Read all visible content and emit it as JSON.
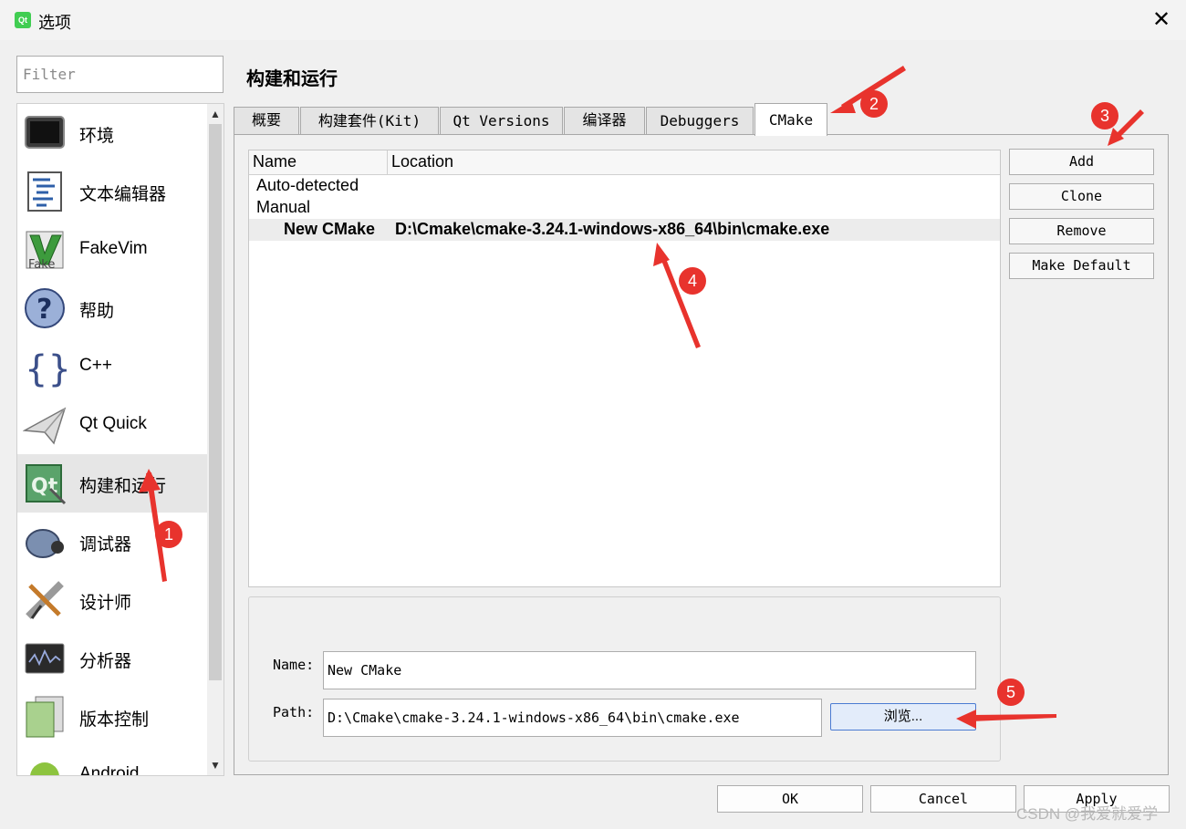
{
  "window": {
    "title": "选项",
    "app_icon_text": "Qt"
  },
  "filter": {
    "placeholder": "Filter"
  },
  "sidebar": {
    "items": [
      {
        "label": "环境",
        "icon": "monitor-icon"
      },
      {
        "label": "文本编辑器",
        "icon": "text-editor-icon"
      },
      {
        "label": "FakeVim",
        "icon": "fakevim-icon"
      },
      {
        "label": "帮助",
        "icon": "help-icon"
      },
      {
        "label": "C++",
        "icon": "braces-icon"
      },
      {
        "label": "Qt Quick",
        "icon": "paper-plane-icon"
      },
      {
        "label": "构建和运行",
        "icon": "qt-build-icon",
        "selected": true
      },
      {
        "label": "调试器",
        "icon": "bug-icon"
      },
      {
        "label": "设计师",
        "icon": "designer-tools-icon"
      },
      {
        "label": "分析器",
        "icon": "oscilloscope-icon"
      },
      {
        "label": "版本控制",
        "icon": "version-control-icon"
      },
      {
        "label": "Android",
        "icon": "android-icon"
      }
    ]
  },
  "page_title": "构建和运行",
  "tabs": [
    "概要",
    "构建套件(Kit)",
    "Qt Versions",
    "编译器",
    "Debuggers",
    "CMake"
  ],
  "active_tab": "CMake",
  "tree": {
    "headers": [
      "Name",
      "Location"
    ],
    "rows": [
      {
        "name": "Auto-detected",
        "location": ""
      },
      {
        "name": "Manual",
        "location": ""
      },
      {
        "name": "New CMake",
        "location": "D:\\Cmake\\cmake-3.24.1-windows-x86_64\\bin\\cmake.exe",
        "selected": true
      }
    ]
  },
  "side_buttons": {
    "add": "Add",
    "clone": "Clone",
    "remove": "Remove",
    "make_default": "Make Default"
  },
  "details": {
    "name_label": "Name:",
    "name_value": "New CMake",
    "path_label": "Path:",
    "path_value": "D:\\Cmake\\cmake-3.24.1-windows-x86_64\\bin\\cmake.exe",
    "browse_label": "浏览..."
  },
  "dialog_buttons": {
    "ok": "OK",
    "cancel": "Cancel",
    "apply": "Apply"
  },
  "annotations": [
    "1",
    "2",
    "3",
    "4",
    "5"
  ],
  "watermark": "CSDN @我爱就爱学",
  "colors": {
    "annotation_red": "#e8332d",
    "browse_border": "#4b7bd2",
    "selected_row": "#ececec"
  }
}
